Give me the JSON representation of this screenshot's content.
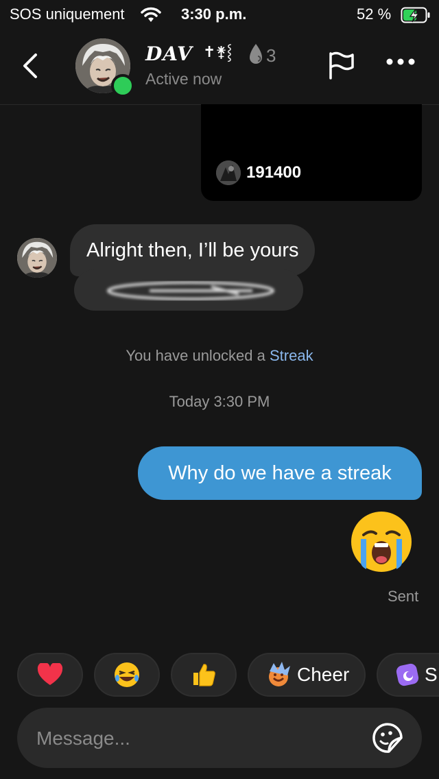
{
  "status_bar": {
    "carrier": "SOS uniquement",
    "time": "3:30 p.m.",
    "battery": "52 %"
  },
  "header": {
    "name": "DAV",
    "name_symbols": "✝︎⚵⸾",
    "streak_count": "3",
    "presence": "Active now",
    "presence_color": "#2ecc58"
  },
  "messages": {
    "shared_post_count": "191400",
    "incoming_text": "Alright then, I’ll be yours",
    "streak_notice_prefix": "You have unlocked a ",
    "streak_notice_link": "Streak",
    "timestamp": "Today 3:30 PM",
    "outgoing_text": "Why do we have a streak",
    "outgoing_emoji": "loudly-crying-face",
    "status": "Sent"
  },
  "quick_reactions": [
    {
      "icon": "heart-icon"
    },
    {
      "icon": "laughing-face-icon"
    },
    {
      "icon": "thumbs-up-icon"
    },
    {
      "icon": "cheer-icon",
      "label": "Cheer"
    },
    {
      "icon": "sticker-app-icon",
      "label": "S"
    }
  ],
  "composer": {
    "placeholder": "Message..."
  },
  "colors": {
    "outgoing_bubble": "#3e96d3",
    "incoming_bubble": "#2f2f2f",
    "link": "#8ab7ec"
  }
}
